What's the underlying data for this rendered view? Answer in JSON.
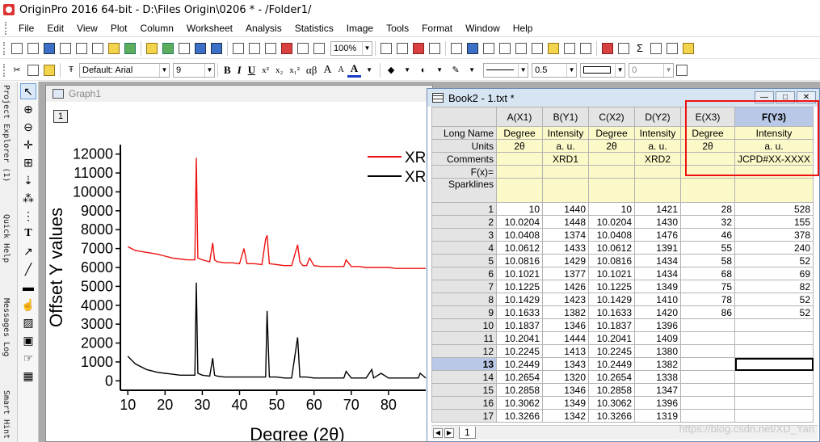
{
  "title": "OriginPro 2016 64-bit - D:\\Files Origin\\0206 * - /Folder1/",
  "menu": [
    "File",
    "Edit",
    "View",
    "Plot",
    "Column",
    "Worksheet",
    "Analysis",
    "Statistics",
    "Image",
    "Tools",
    "Format",
    "Window",
    "Help"
  ],
  "toolbar": {
    "zoom": "100%",
    "font": "Default: Arial",
    "font_size": "9",
    "bold": "B",
    "italic": "I",
    "underline": "U",
    "sup": "x²",
    "sub": "x₂",
    "supsub": "x₁²",
    "greek": "αβ",
    "big_a": "A",
    "small_a": "A",
    "font_color": "A",
    "line_width": "0.5",
    "spin_value": "0"
  },
  "side_tabs": [
    "Project Explorer (1)",
    "Quick Help",
    "Messages Log",
    "Smart Hint"
  ],
  "graph": {
    "title": "Graph1",
    "layer": "1",
    "legend": [
      {
        "name": "XRD",
        "color": "#ee1111"
      },
      {
        "name": "XRD",
        "color": "#000000"
      }
    ]
  },
  "chart_data": {
    "type": "line",
    "xlabel": "Degree (2θ)",
    "ylabel": "Offset Y values",
    "xlim": [
      8,
      90
    ],
    "ylim": [
      -500,
      12500
    ],
    "xticks": [
      "10",
      "20",
      "30",
      "40",
      "50",
      "60",
      "70",
      "80"
    ],
    "yticks": [
      "0",
      "1000",
      "2000",
      "3000",
      "4000",
      "5000",
      "6000",
      "7000",
      "8000",
      "9000",
      "10000",
      "11000",
      "12000"
    ],
    "series": [
      {
        "name": "XRD",
        "color": "#ee1111",
        "x": [
          10,
          12,
          15,
          18,
          20,
          22,
          24,
          26,
          28,
          28.4,
          28.8,
          30,
          32,
          32.8,
          33.3,
          34,
          36,
          38,
          40,
          41.2,
          42,
          44,
          46,
          47,
          47.4,
          48,
          50,
          52,
          54,
          55.6,
          56.2,
          57,
          58,
          58.8,
          60,
          62,
          64,
          66,
          68,
          68.6,
          70,
          72,
          74,
          76,
          78,
          80,
          82,
          84,
          86,
          88,
          90
        ],
        "y": [
          7100,
          6900,
          6800,
          6700,
          6600,
          6500,
          6450,
          6400,
          6400,
          11800,
          6500,
          6400,
          6300,
          7300,
          6400,
          6300,
          6250,
          6250,
          6200,
          7000,
          6200,
          6200,
          6150,
          7500,
          7700,
          6200,
          6150,
          6100,
          6100,
          7200,
          6300,
          6100,
          6100,
          6500,
          6100,
          6050,
          6050,
          6050,
          6050,
          6400,
          6050,
          6050,
          6000,
          6000,
          6000,
          6000,
          5950,
          5950,
          5950,
          5950,
          5950
        ]
      },
      {
        "name": "XRD",
        "color": "#000000",
        "x": [
          10,
          12,
          15,
          18,
          20,
          22,
          24,
          26,
          28,
          28.4,
          28.8,
          30,
          32,
          32.8,
          33.3,
          34,
          36,
          38,
          40,
          42,
          44,
          46,
          47,
          47.4,
          48,
          50,
          52,
          54,
          55.6,
          56.2,
          58,
          60,
          62,
          64,
          66,
          68,
          68.6,
          70,
          72,
          74,
          75.5,
          76,
          78,
          80,
          82,
          84,
          86,
          88,
          88.5,
          90
        ],
        "y": [
          1300,
          900,
          600,
          450,
          400,
          350,
          300,
          300,
          300,
          5200,
          400,
          300,
          250,
          1200,
          300,
          250,
          200,
          200,
          200,
          200,
          200,
          200,
          200,
          3700,
          200,
          200,
          150,
          150,
          2300,
          200,
          200,
          150,
          150,
          150,
          150,
          150,
          500,
          150,
          150,
          150,
          600,
          150,
          400,
          150,
          150,
          150,
          150,
          150,
          400,
          150
        ]
      }
    ]
  },
  "book": {
    "title": "Book2 - 1.txt *",
    "columns": [
      "A(X1)",
      "B(Y1)",
      "C(X2)",
      "D(Y2)",
      "E(X3)",
      "F(Y3)"
    ],
    "meta_labels": [
      "Long Name",
      "Units",
      "Comments",
      "F(x)=",
      "Sparklines"
    ],
    "long_name": [
      "Degree",
      "Intensity",
      "Degree",
      "Intensity",
      "Degree",
      "Intensity"
    ],
    "units": [
      "2θ",
      "a. u.",
      "2θ",
      "a. u.",
      "2θ",
      "a. u."
    ],
    "comments": [
      "",
      "XRD1",
      "",
      "XRD2",
      "",
      "JCPD#XX-XXXX"
    ],
    "rows": [
      [
        "1",
        "10",
        "1440",
        "10",
        "1421",
        "28",
        "528"
      ],
      [
        "2",
        "10.0204",
        "1448",
        "10.0204",
        "1430",
        "32",
        "155"
      ],
      [
        "3",
        "10.0408",
        "1374",
        "10.0408",
        "1476",
        "46",
        "378"
      ],
      [
        "4",
        "10.0612",
        "1433",
        "10.0612",
        "1391",
        "55",
        "240"
      ],
      [
        "5",
        "10.0816",
        "1429",
        "10.0816",
        "1434",
        "58",
        "52"
      ],
      [
        "6",
        "10.1021",
        "1377",
        "10.1021",
        "1434",
        "68",
        "69"
      ],
      [
        "7",
        "10.1225",
        "1426",
        "10.1225",
        "1349",
        "75",
        "82"
      ],
      [
        "8",
        "10.1429",
        "1423",
        "10.1429",
        "1410",
        "78",
        "52"
      ],
      [
        "9",
        "10.1633",
        "1382",
        "10.1633",
        "1420",
        "86",
        "52"
      ],
      [
        "10",
        "10.1837",
        "1346",
        "10.1837",
        "1396",
        "",
        ""
      ],
      [
        "11",
        "10.2041",
        "1444",
        "10.2041",
        "1409",
        "",
        ""
      ],
      [
        "12",
        "10.2245",
        "1413",
        "10.2245",
        "1380",
        "",
        ""
      ],
      [
        "13",
        "10.2449",
        "1343",
        "10.2449",
        "1382",
        "",
        ""
      ],
      [
        "14",
        "10.2654",
        "1320",
        "10.2654",
        "1338",
        "",
        ""
      ],
      [
        "15",
        "10.2858",
        "1346",
        "10.2858",
        "1347",
        "",
        ""
      ],
      [
        "16",
        "10.3062",
        "1349",
        "10.3062",
        "1396",
        "",
        ""
      ],
      [
        "17",
        "10.3266",
        "1342",
        "10.3266",
        "1319",
        "",
        ""
      ]
    ],
    "sheet_tab": "1",
    "active_row": "13"
  },
  "watermark": "https://blog.csdn.net/XD_Yan"
}
